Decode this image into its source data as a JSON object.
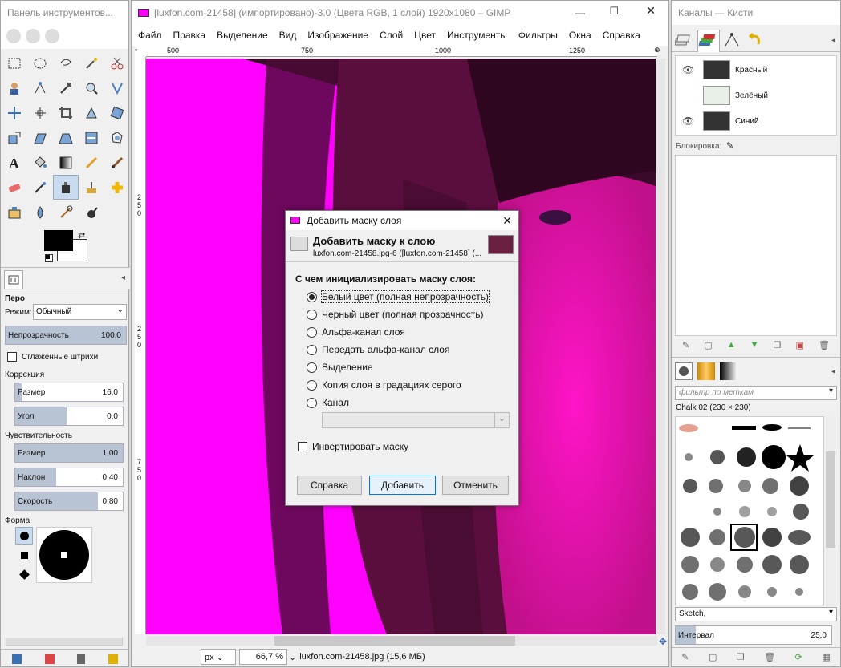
{
  "toolbox": {
    "title": "Панель инструментов...",
    "tool_name": "Перо",
    "mode_label": "Режим:",
    "mode_value": "Обычный",
    "opacity_label": "Непрозрачность",
    "opacity_value": "100,0",
    "smooth_label": "Сглаженные штрихи",
    "correction_label": "Коррекция",
    "size_label": "Размер",
    "size_value": "16,0",
    "angle_label": "Угол",
    "angle_value": "0,0",
    "sensitivity_label": "Чувствительность",
    "sens_size_label": "Размер",
    "sens_size_value": "1,00",
    "tilt_label": "Наклон",
    "tilt_value": "0,40",
    "speed_label": "Скорость",
    "speed_value": "0,80",
    "shape_label": "Форма"
  },
  "main": {
    "title": "[luxfon.com-21458] (импортировано)-3.0 (Цвета RGB, 1 слой) 1920x1080 – GIMP",
    "menu": [
      "Файл",
      "Правка",
      "Выделение",
      "Вид",
      "Изображение",
      "Слой",
      "Цвет",
      "Инструменты",
      "Фильтры",
      "Окна",
      "Справка"
    ],
    "ruler_h": [
      "500",
      "750",
      "1000",
      "1250"
    ],
    "ruler_v": [
      "2",
      "5",
      "0",
      "2",
      "5",
      "0",
      "5",
      "0",
      "7",
      "5",
      "0"
    ],
    "status_unit": "px",
    "status_zoom": "66,7 %",
    "status_file": "luxfon.com-21458.jpg (15,6 МБ)"
  },
  "dialog": {
    "title": "Добавить маску слоя",
    "heading": "Добавить маску к слою",
    "subheading": "luxfon.com-21458.jpg-6 ([luxfon.com-21458] (...",
    "question": "С чем инициализировать маску слоя:",
    "options": [
      "Белый цвет (полная непрозрачность)",
      "Черный цвет (полная прозрачность)",
      "Альфа-канал слоя",
      "Передать альфа-канал слоя",
      "Выделение",
      "Копия слоя в градациях серого",
      "Канал"
    ],
    "invert_label": "Инвертировать маску",
    "help_btn": "Справка",
    "add_btn": "Добавить",
    "cancel_btn": "Отменить"
  },
  "dock": {
    "title": "Каналы — Кисти",
    "channels": [
      "Красный",
      "Зелёный",
      "Синий"
    ],
    "lock_label": "Блокировка:",
    "filter_placeholder": "фильтр по меткам",
    "brush_name": "Chalk 02 (230 × 230)",
    "brush_preset": "Sketch,",
    "spacing_label": "Интервал",
    "spacing_value": "25,0"
  },
  "colors": {
    "canvas": "#ff00ff",
    "accent": "#b8c4d4"
  }
}
